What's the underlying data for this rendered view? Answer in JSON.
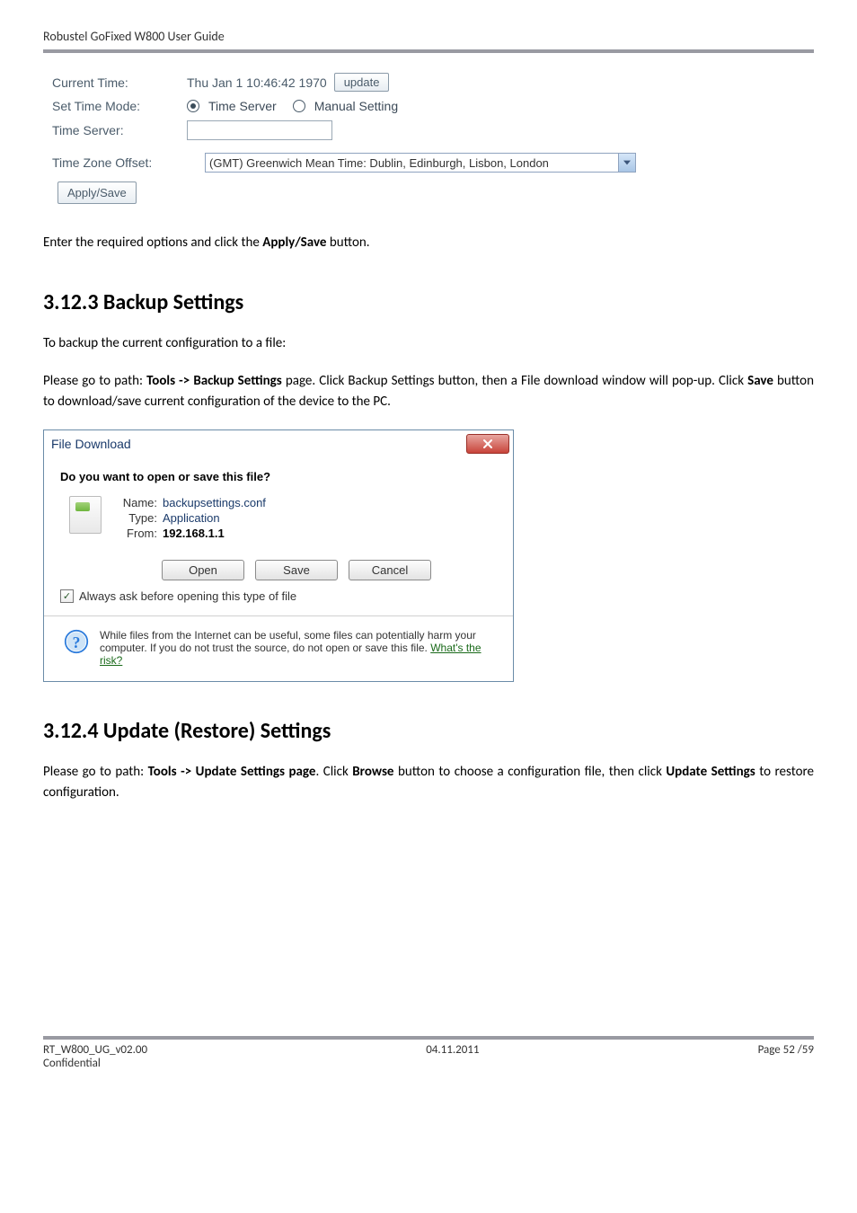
{
  "header": {
    "title": "Robustel GoFixed W800 User Guide"
  },
  "settings": {
    "current_time_label": "Current Time:",
    "current_time_value": "Thu Jan 1 10:46:42 1970",
    "update_label": "update",
    "set_time_mode_label": "Set Time Mode:",
    "option_time_server": "Time Server",
    "option_manual": "Manual Setting",
    "time_server_label": "Time Server:",
    "time_server_value": "",
    "tz_offset_label": "Time Zone Offset:",
    "tz_value": "(GMT) Greenwich Mean Time: Dublin, Edinburgh, Lisbon, London",
    "apply_save": "Apply/Save"
  },
  "body": {
    "para1_pre": "Enter the required options and click the ",
    "para1_bold": "Apply/Save",
    "para1_post": " button."
  },
  "section_backup": {
    "heading": "3.12.3 Backup Settings",
    "para_intro": "To backup the current configuration to a file:",
    "para2_a": "Please go to path: ",
    "para2_b": "Tools -> Backup Settings",
    "para2_c": " page. Click Backup Settings button, then a File download window will pop-up. Click ",
    "para2_d": "Save",
    "para2_e": " button to download/save current configuration of the device to the PC."
  },
  "dialog": {
    "title": "File Download",
    "question": "Do you want to open or save this file?",
    "name_label": "Name:",
    "name_value": "backupsettings.conf",
    "type_label": "Type:",
    "type_value": "Application",
    "from_label": "From:",
    "from_value": "192.168.1.1",
    "open": "Open",
    "save": "Save",
    "cancel": "Cancel",
    "always_ask": "Always ask before opening this type of file",
    "warn1": "While files from the Internet can be useful, some files can potentially harm your computer. If you do not trust the source, do not open or save this file. ",
    "warn_link": "What's the risk?"
  },
  "section_update": {
    "heading": "3.12.4 Update (Restore) Settings",
    "para_a": "Please go to path: ",
    "para_b": "Tools -> Update Settings page",
    "para_c": ". Click ",
    "para_d": "Browse",
    "para_e": " button to choose a configuration file, then click ",
    "para_f": "Update Settings",
    "para_g": " to restore configuration."
  },
  "footer": {
    "left": "RT_W800_UG_v02.00",
    "center": "04.11.2011",
    "right": "Page 52 /59",
    "confidential": "Confidential"
  }
}
